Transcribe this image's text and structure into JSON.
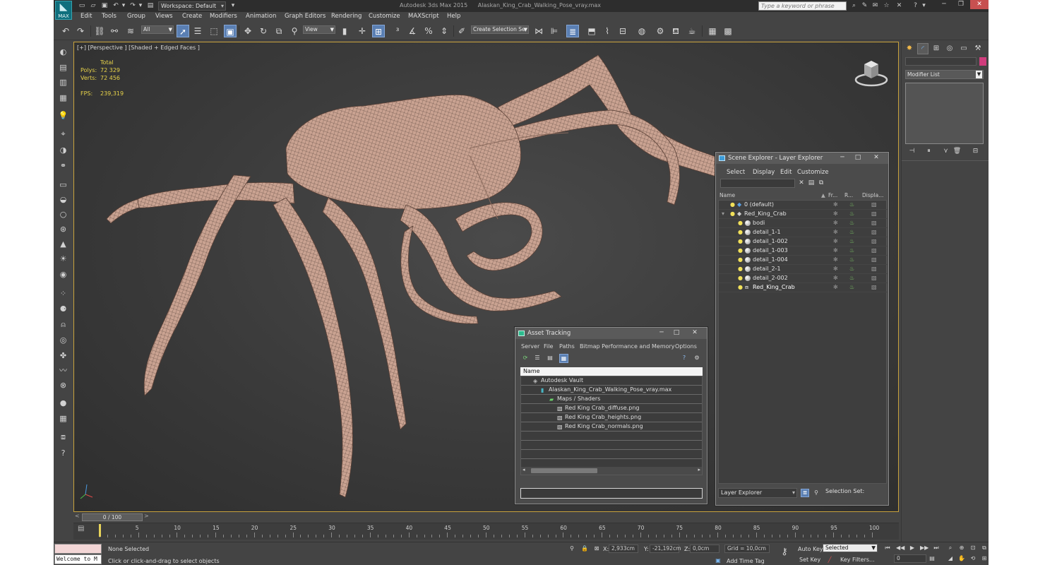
{
  "titlebar": {
    "logo_label": "MAX",
    "workspace_value": "Workspace: Default",
    "app_name": "Autodesk 3ds Max 2015",
    "file_name": "Alaskan_King_Crab_Walking_Pose_vray.max",
    "search_placeholder": "Type a keyword or phrase"
  },
  "menus": [
    "Edit",
    "Tools",
    "Group",
    "Views",
    "Create",
    "Modifiers",
    "Animation",
    "Graph Editors",
    "Rendering",
    "Customize",
    "MAXScript",
    "Help"
  ],
  "toolbar": {
    "selection_filter": "All",
    "reference_coord": "View",
    "named_selection_placeholder": "Create Selection Se"
  },
  "viewport": {
    "label": "[+] [Perspective ] [Shaded + Edged Faces ]",
    "stats_header": "Total",
    "polys_label": "Polys:",
    "polys_value": "72 329",
    "verts_label": "Verts:",
    "verts_value": "72 456",
    "fps_label": "FPS:",
    "fps_value": "239,319",
    "mesh_color": "#c9a291",
    "wire_color": "#3a2a24"
  },
  "scene_explorer": {
    "title": "Scene Explorer - Layer Explorer",
    "menus": [
      "Select",
      "Display",
      "Edit",
      "Customize"
    ],
    "columns": [
      "Name",
      "Fr...",
      "R...",
      "Displa..."
    ],
    "rows": [
      {
        "name": "0 (default)",
        "depth": 0,
        "type": "layer"
      },
      {
        "name": "Red_King_Crab",
        "depth": 0,
        "type": "layer"
      },
      {
        "name": "bodi",
        "depth": 1,
        "type": "object"
      },
      {
        "name": "detail_1-1",
        "depth": 1,
        "type": "object"
      },
      {
        "name": "detail_1-002",
        "depth": 1,
        "type": "object"
      },
      {
        "name": "detail_1-003",
        "depth": 1,
        "type": "object"
      },
      {
        "name": "detail_1-004",
        "depth": 1,
        "type": "object"
      },
      {
        "name": "detail_2-1",
        "depth": 1,
        "type": "object"
      },
      {
        "name": "detail_2-002",
        "depth": 1,
        "type": "object"
      },
      {
        "name": "Red_King_Crab",
        "depth": 1,
        "type": "group"
      }
    ],
    "explorer_select": "Layer Explorer",
    "selection_set_label": "Selection Set:"
  },
  "asset_tracking": {
    "title": "Asset Tracking",
    "menus": [
      "Server",
      "File",
      "Paths",
      "Bitmap Performance and Memory",
      "Options"
    ],
    "column_name": "Name",
    "rows": [
      {
        "name": "Autodesk Vault",
        "depth": 0,
        "icon": "vault-icon"
      },
      {
        "name": "Alaskan_King_Crab_Walking_Pose_vray.max",
        "depth": 1,
        "icon": "max-file-icon"
      },
      {
        "name": "Maps / Shaders",
        "depth": 2,
        "icon": "maps-icon"
      },
      {
        "name": "Red King Crab_diffuse.png",
        "depth": 3,
        "icon": "image-file-icon"
      },
      {
        "name": "Red King Crab_heights.png",
        "depth": 3,
        "icon": "image-file-icon"
      },
      {
        "name": "Red King Crab_normals.png",
        "depth": 3,
        "icon": "image-file-icon"
      }
    ]
  },
  "command_panel": {
    "modifier_list": "Modifier List",
    "color_swatch": "#d03c7c"
  },
  "timeline": {
    "frame_display": "0 / 100",
    "ticks": [
      "5",
      "10",
      "15",
      "20",
      "25",
      "30",
      "35",
      "40",
      "45",
      "50",
      "55",
      "60",
      "65",
      "70",
      "75",
      "80",
      "85",
      "90",
      "95",
      "100"
    ]
  },
  "statusbar": {
    "script_listener": "Welcome to M",
    "selection_status": "None Selected",
    "prompt": "Click or click-and-drag to select objects",
    "x_label": "X:",
    "x_value": "2,933cm",
    "y_label": "Y:",
    "y_value": "-21,192cm",
    "z_label": "Z:",
    "z_value": "0,0cm",
    "grid": "Grid = 10,0cm",
    "add_time_tag": "Add Time Tag",
    "auto_key": "Auto Key",
    "set_key": "Set Key",
    "key_mode": "Selected",
    "key_filters": "Key Filters...",
    "current_frame": "0"
  }
}
